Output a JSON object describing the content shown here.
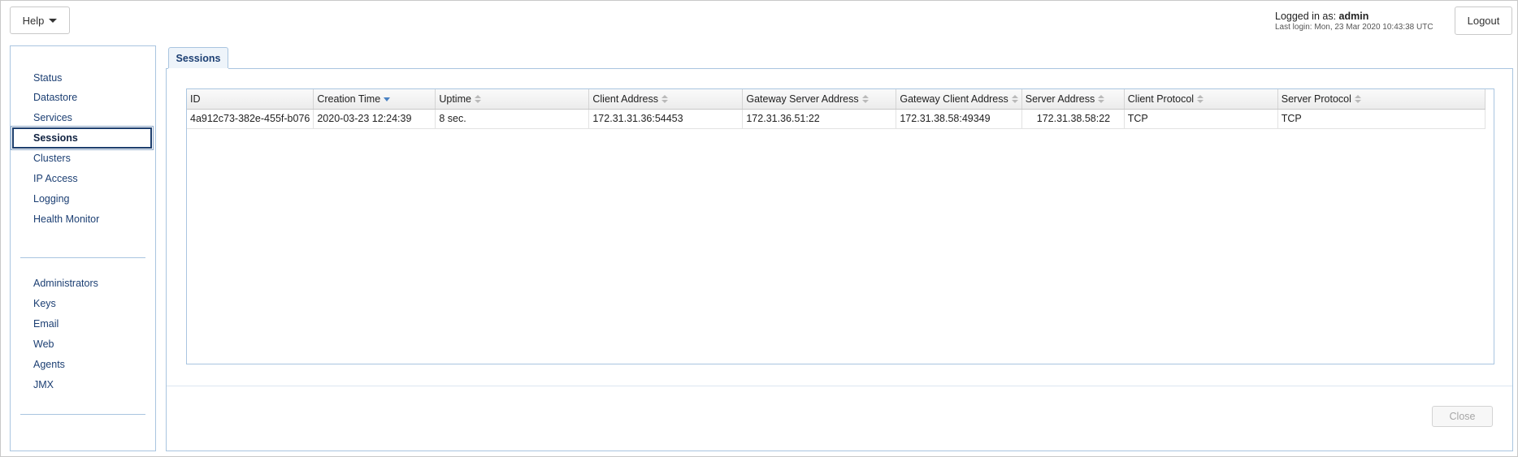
{
  "header": {
    "help_label": "Help",
    "logged_in_prefix": "Logged in as: ",
    "username": "admin",
    "last_login": "Last login: Mon, 23 Mar 2020 10:43:38 UTC",
    "logout_label": "Logout"
  },
  "sidebar": {
    "group1": [
      {
        "label": "Status"
      },
      {
        "label": "Datastore"
      },
      {
        "label": "Services"
      },
      {
        "label": "Sessions",
        "active": true
      },
      {
        "label": "Clusters"
      },
      {
        "label": "IP Access"
      },
      {
        "label": "Logging"
      },
      {
        "label": "Health Monitor"
      }
    ],
    "group2": [
      {
        "label": "Administrators"
      },
      {
        "label": "Keys"
      },
      {
        "label": "Email"
      },
      {
        "label": "Web"
      },
      {
        "label": "Agents"
      },
      {
        "label": "JMX"
      }
    ]
  },
  "main": {
    "tab_label": "Sessions",
    "table": {
      "columns": [
        "ID",
        "Creation Time",
        "Uptime",
        "Client Address",
        "Gateway Server Address",
        "Gateway Client Address",
        "Server Address",
        "Client Protocol",
        "Server Protocol"
      ],
      "sorted_column": "Creation Time",
      "rows": [
        [
          "4a912c73-382e-455f-b076",
          "2020-03-23 12:24:39",
          "8 sec.",
          "172.31.31.36:54453",
          "172.31.36.51:22",
          "172.31.38.58:49349",
          "172.31.38.58:22",
          "TCP",
          "TCP"
        ]
      ]
    },
    "close_label": "Close"
  },
  "colors": {
    "border_accent": "#a9c5e0",
    "nav_text": "#1c3f73",
    "active_border": "#1e3f6e"
  }
}
